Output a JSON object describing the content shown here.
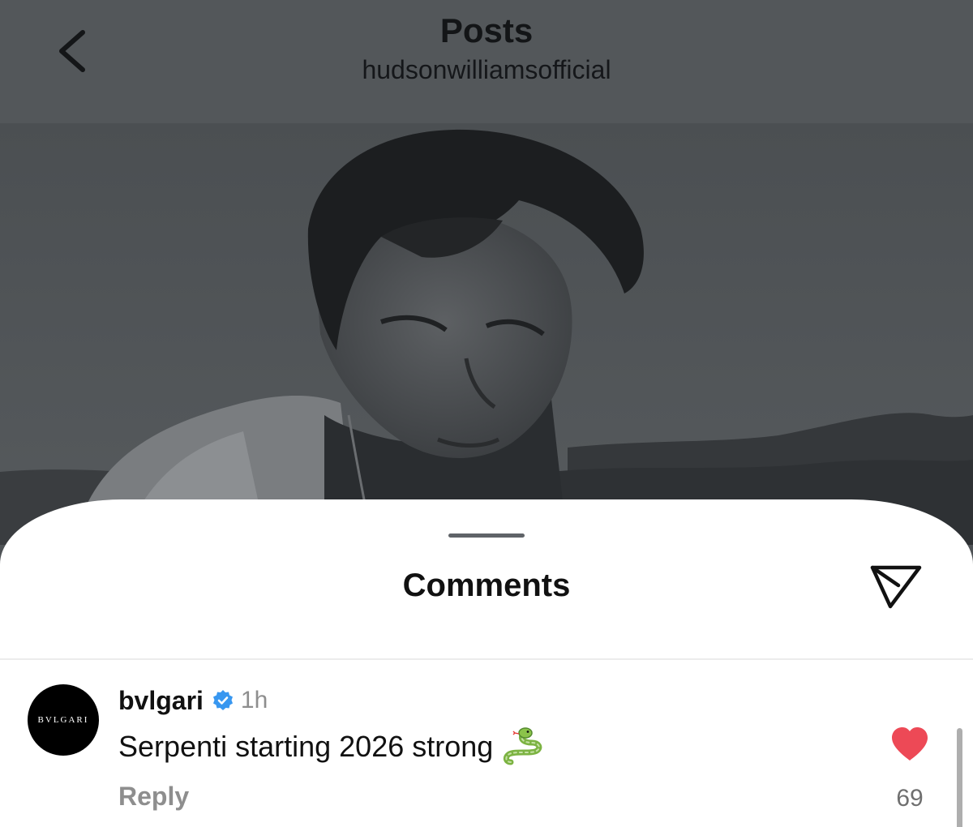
{
  "header": {
    "title": "Posts",
    "subtitle": "hudsonwilliamsofficial",
    "back_icon": "chevron-left-icon"
  },
  "post_image": {
    "description_icon": "post-photo"
  },
  "comments_sheet": {
    "title": "Comments",
    "share_icon": "send-icon"
  },
  "comments": [
    {
      "avatar_text": "BVLGARI",
      "username": "bvlgari",
      "verified": true,
      "time": "1h",
      "text": "Serpenti starting 2026 strong",
      "emoji_icon": "snake-icon",
      "reply_label": "Reply",
      "liked": true,
      "like_count": "69",
      "like_color": "#ed4956"
    }
  ],
  "colors": {
    "verified_badge": "#3897f0",
    "muted_text": "#8e8e8e",
    "overlay": "#53575a"
  }
}
